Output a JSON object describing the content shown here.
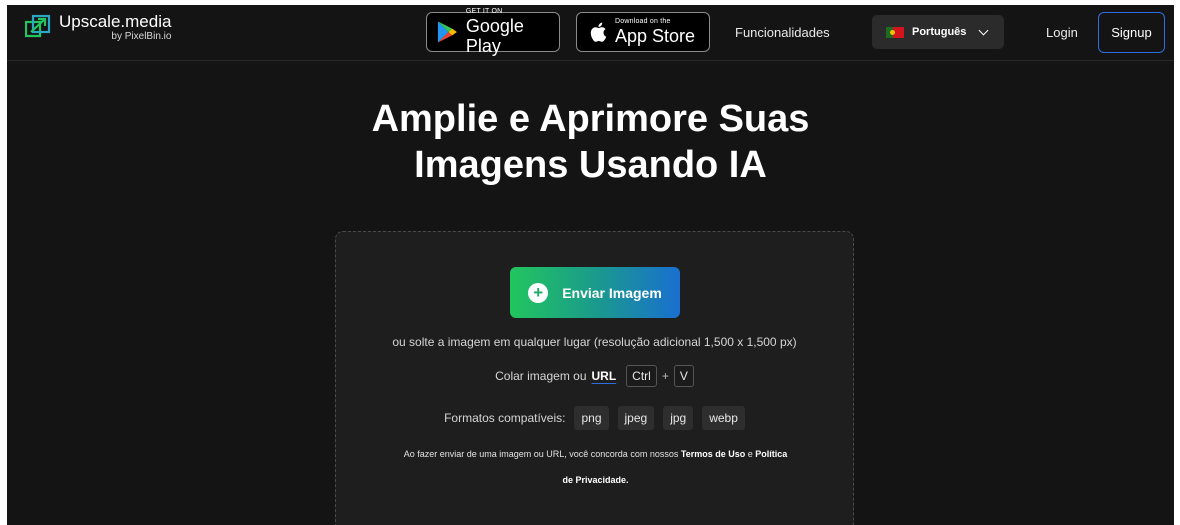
{
  "header": {
    "logo_title": "Upscale.media",
    "logo_sub": "by PixelBin.io",
    "google_play_small": "GET IT ON",
    "google_play_big": "Google Play",
    "app_store_small": "Download on the",
    "app_store_big": "App Store",
    "features_link": "Funcionalidades",
    "language": "Português",
    "login": "Login",
    "signup": "Signup"
  },
  "hero": {
    "title_line1": "Amplie e Aprimore Suas",
    "title_line2": "Imagens Usando IA"
  },
  "upload": {
    "button_label": "Enviar Imagem",
    "drop_hint": "ou solte a imagem em qualquer lugar (resolução adicional 1,500 x 1,500 px)",
    "paste_label": "Colar imagem ou",
    "url_label": "URL",
    "key_ctrl": "Ctrl",
    "key_plus": "+",
    "key_v": "V",
    "formats_label": "Formatos compatíveis:",
    "formats": [
      "png",
      "jpeg",
      "jpg",
      "webp"
    ],
    "terms_prefix": "Ao fazer enviar de uma imagem ou URL, você concorda com nossos",
    "terms_link": "Termos de Uso",
    "terms_and": "e",
    "privacy_link_1": "Política",
    "privacy_link_2": "de Privacidade."
  },
  "colors": {
    "background": "#141414",
    "accent_blue": "#2d6fe0",
    "gradient_start": "#22c55e",
    "gradient_end": "#1a6fd1"
  }
}
